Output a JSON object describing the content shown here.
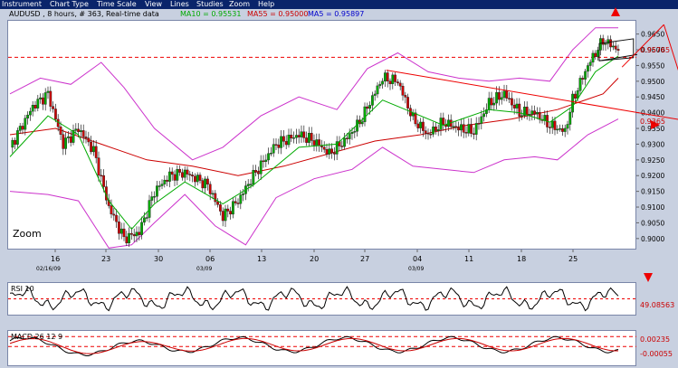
{
  "menu": [
    "Instrument",
    "Chart Type",
    "Time Scale",
    "View",
    "Lines",
    "Studies",
    "Zoom",
    "Help"
  ],
  "main": {
    "info_prefix": "AUDUSD , 8 hours, # 363, Real-time data",
    "ma10_label": "MA10 = 0.95531",
    "ma55_label": "MA55 = 0.95000",
    "ma5_label": "MA5 = 0.95897",
    "zoom_label": "Zoom",
    "y_ticks": [
      "0.9650",
      "0.9600",
      "0.9550",
      "0.9500",
      "0.9450",
      "0.9400",
      "0.9350",
      "0.9300",
      "0.9250",
      "0.9200",
      "0.9150",
      "0.9100",
      "0.9050",
      "0.9000"
    ],
    "price_label": "0.95765",
    "red_box_label": "0.9365",
    "x_ticks": [
      "16",
      "23",
      "30",
      "06",
      "13",
      "20",
      "27",
      "04",
      "11",
      "18",
      "25"
    ],
    "month_labels": [
      "02/16/09",
      "03/09",
      "03/09"
    ]
  },
  "rsi": {
    "title": "RSI 10",
    "value_label": "49.08563"
  },
  "macd": {
    "title": "MACD 26 12 9",
    "value_label": "0.00235",
    "value_label_2": "-0.00055"
  },
  "colors": {
    "menubar": "#0a246a",
    "ma10": "#00aa00",
    "ma55": "#cc0000",
    "ma5": "#0000cc",
    "bollinger": "#cc33cc",
    "candle_up": "#00aa00",
    "candle_down": "#cc0000",
    "trendline": "#ee0000"
  },
  "chart_data": {
    "type": "candlestick",
    "ylim": [
      0.8965,
      0.9695
    ],
    "samples": 80,
    "close_path": [
      [
        0,
        0.929
      ],
      [
        3,
        0.942
      ],
      [
        5,
        0.946
      ],
      [
        7,
        0.93
      ],
      [
        9,
        0.935
      ],
      [
        11,
        0.928
      ],
      [
        13,
        0.91
      ],
      [
        15,
        0.9
      ],
      [
        17,
        0.902
      ],
      [
        19,
        0.915
      ],
      [
        21,
        0.92
      ],
      [
        23,
        0.921
      ],
      [
        26,
        0.917
      ],
      [
        28,
        0.907
      ],
      [
        30,
        0.912
      ],
      [
        32,
        0.92
      ],
      [
        35,
        0.93
      ],
      [
        38,
        0.933
      ],
      [
        40,
        0.931
      ],
      [
        42,
        0.927
      ],
      [
        44,
        0.931
      ],
      [
        46,
        0.937
      ],
      [
        49,
        0.951
      ],
      [
        51,
        0.95
      ],
      [
        53,
        0.938
      ],
      [
        55,
        0.933
      ],
      [
        57,
        0.937
      ],
      [
        59,
        0.935
      ],
      [
        61,
        0.934
      ],
      [
        63,
        0.943
      ],
      [
        65,
        0.946
      ],
      [
        67,
        0.94
      ],
      [
        69,
        0.94
      ],
      [
        71,
        0.936
      ],
      [
        73,
        0.934
      ],
      [
        74,
        0.944
      ],
      [
        76,
        0.955
      ],
      [
        78,
        0.963
      ],
      [
        80,
        0.96
      ]
    ],
    "ma10_path": [
      [
        0,
        0.926
      ],
      [
        5,
        0.939
      ],
      [
        9,
        0.933
      ],
      [
        13,
        0.912
      ],
      [
        16,
        0.903
      ],
      [
        19,
        0.911
      ],
      [
        23,
        0.918
      ],
      [
        28,
        0.911
      ],
      [
        32,
        0.917
      ],
      [
        38,
        0.929
      ],
      [
        43,
        0.93
      ],
      [
        49,
        0.944
      ],
      [
        53,
        0.94
      ],
      [
        57,
        0.936
      ],
      [
        63,
        0.941
      ],
      [
        67,
        0.94
      ],
      [
        71,
        0.937
      ],
      [
        74,
        0.942
      ],
      [
        77,
        0.953
      ],
      [
        80,
        0.958
      ]
    ],
    "ma55_path": [
      [
        0,
        0.933
      ],
      [
        6,
        0.935
      ],
      [
        12,
        0.93
      ],
      [
        18,
        0.925
      ],
      [
        24,
        0.923
      ],
      [
        30,
        0.92
      ],
      [
        36,
        0.923
      ],
      [
        42,
        0.927
      ],
      [
        48,
        0.931
      ],
      [
        54,
        0.933
      ],
      [
        60,
        0.936
      ],
      [
        66,
        0.938
      ],
      [
        72,
        0.941
      ],
      [
        78,
        0.946
      ],
      [
        80,
        0.951
      ]
    ],
    "bb_upper_path": [
      [
        0,
        0.946
      ],
      [
        4,
        0.951
      ],
      [
        8,
        0.949
      ],
      [
        12,
        0.956
      ],
      [
        15,
        0.948
      ],
      [
        19,
        0.935
      ],
      [
        24,
        0.925
      ],
      [
        28,
        0.929
      ],
      [
        33,
        0.939
      ],
      [
        38,
        0.945
      ],
      [
        43,
        0.941
      ],
      [
        47,
        0.954
      ],
      [
        51,
        0.959
      ],
      [
        55,
        0.953
      ],
      [
        59,
        0.951
      ],
      [
        63,
        0.95
      ],
      [
        67,
        0.951
      ],
      [
        71,
        0.95
      ],
      [
        74,
        0.96
      ],
      [
        77,
        0.967
      ],
      [
        80,
        0.967
      ]
    ],
    "bb_lower_path": [
      [
        0,
        0.915
      ],
      [
        5,
        0.914
      ],
      [
        9,
        0.912
      ],
      [
        13,
        0.897
      ],
      [
        16,
        0.898
      ],
      [
        19,
        0.905
      ],
      [
        23,
        0.914
      ],
      [
        27,
        0.904
      ],
      [
        31,
        0.898
      ],
      [
        35,
        0.913
      ],
      [
        40,
        0.919
      ],
      [
        45,
        0.922
      ],
      [
        49,
        0.929
      ],
      [
        53,
        0.923
      ],
      [
        57,
        0.922
      ],
      [
        61,
        0.921
      ],
      [
        65,
        0.925
      ],
      [
        69,
        0.926
      ],
      [
        72,
        0.925
      ],
      [
        76,
        0.933
      ],
      [
        80,
        0.938
      ]
    ],
    "hlines": [
      0.9576
    ],
    "trendlines": [
      {
        "from": [
          49.5,
          0.9535
        ],
        "to": [
          90.0,
          0.937
        ]
      },
      {
        "from": [
          80.5,
          0.9545
        ],
        "to": [
          86.0,
          0.968
        ]
      },
      {
        "from": [
          86.0,
          0.968
        ],
        "to": [
          90.0,
          0.9375
        ]
      }
    ],
    "channel": [
      [
        77.5,
        0.962
      ],
      [
        82.0,
        0.9635
      ],
      [
        82.0,
        0.9575
      ],
      [
        77.5,
        0.9565
      ]
    ],
    "rsi_ylim": [
      20,
      80
    ],
    "rsi_level": 50,
    "macd_ylim": [
      -0.006,
      0.004
    ],
    "macd_levels": [
      0.00235,
      -0.00055
    ]
  }
}
